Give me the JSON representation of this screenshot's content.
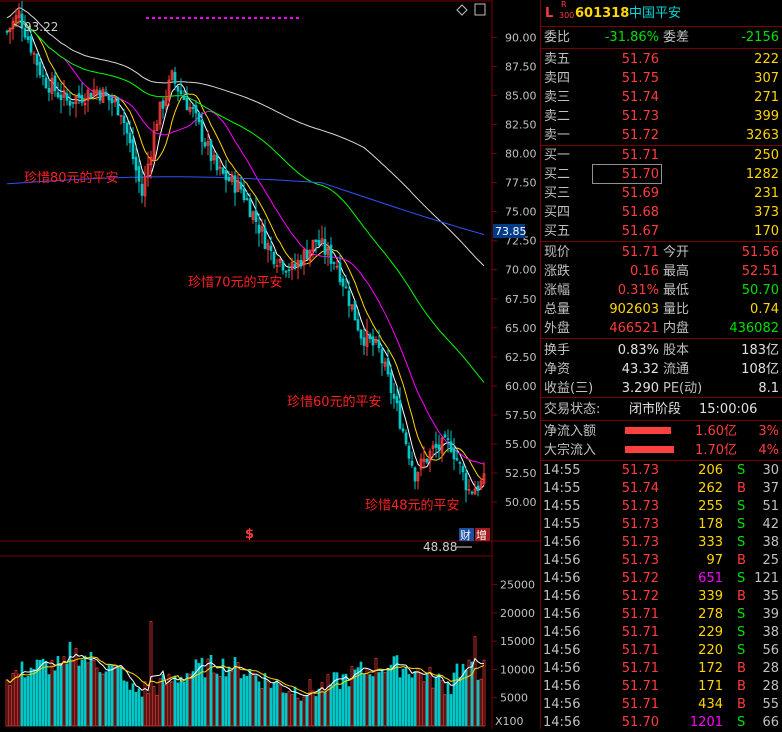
{
  "header": {
    "market_letter": "L",
    "r_mark": "R",
    "index_tag": "300",
    "code": "601318",
    "name": "中国平安"
  },
  "ratio": {
    "label1": "委比",
    "value1": "-31.86%",
    "label2": "委差",
    "value2": "-2156"
  },
  "asks": [
    {
      "label": "卖五",
      "price": "51.76",
      "vol": "222"
    },
    {
      "label": "卖四",
      "price": "51.75",
      "vol": "307"
    },
    {
      "label": "卖三",
      "price": "51.74",
      "vol": "271"
    },
    {
      "label": "卖二",
      "price": "51.73",
      "vol": "399"
    },
    {
      "label": "卖一",
      "price": "51.72",
      "vol": "3263"
    }
  ],
  "bids": [
    {
      "label": "买一",
      "price": "51.71",
      "vol": "250"
    },
    {
      "label": "买二",
      "price": "51.70",
      "vol": "1282"
    },
    {
      "label": "买三",
      "price": "51.69",
      "vol": "231"
    },
    {
      "label": "买四",
      "price": "51.68",
      "vol": "373"
    },
    {
      "label": "买五",
      "price": "51.67",
      "vol": "170"
    }
  ],
  "quote": [
    {
      "l1": "现价",
      "v1": "51.71",
      "l2": "今开",
      "v2": "51.56"
    },
    {
      "l1": "涨跌",
      "v1": "0.16",
      "l2": "最高",
      "v2": "52.51"
    },
    {
      "l1": "涨幅",
      "v1": "0.31%",
      "l2": "最低",
      "v2": "50.70"
    },
    {
      "l1": "总量",
      "v1": "902603",
      "l2": "量比",
      "v2": "0.74"
    },
    {
      "l1": "外盘",
      "v1": "466521",
      "l2": "内盘",
      "v2": "436082"
    }
  ],
  "fund": [
    {
      "l1": "换手",
      "v1": "0.83%",
      "l2": "股本",
      "v2": "183亿"
    },
    {
      "l1": "净资",
      "v1": "43.32",
      "l2": "流通",
      "v2": "108亿"
    },
    {
      "l1": "收益(三)",
      "v1": "3.290",
      "l2": "PE(动)",
      "v2": "8.1"
    }
  ],
  "trade_status": {
    "label": "交易状态:",
    "phase": "闭市阶段",
    "time": "15:00:06"
  },
  "flows": [
    {
      "label": "净流入额",
      "value": "1.60亿",
      "pct": "3%",
      "fill": 0.8
    },
    {
      "label": "大宗流入",
      "value": "1.70亿",
      "pct": "4%",
      "fill": 0.85
    }
  ],
  "ticks": [
    {
      "t": "14:55",
      "p": "51.73",
      "v": "206",
      "s": "S",
      "n": "30"
    },
    {
      "t": "14:55",
      "p": "51.74",
      "v": "262",
      "s": "B",
      "n": "37"
    },
    {
      "t": "14:55",
      "p": "51.73",
      "v": "255",
      "s": "S",
      "n": "51"
    },
    {
      "t": "14:55",
      "p": "51.73",
      "v": "178",
      "s": "S",
      "n": "42"
    },
    {
      "t": "14:56",
      "p": "51.73",
      "v": "333",
      "s": "S",
      "n": "38"
    },
    {
      "t": "14:56",
      "p": "51.73",
      "v": "97",
      "s": "B",
      "n": "25"
    },
    {
      "t": "14:56",
      "p": "51.72",
      "v": "651",
      "s": "S",
      "n": "121"
    },
    {
      "t": "14:56",
      "p": "51.72",
      "v": "339",
      "s": "B",
      "n": "35"
    },
    {
      "t": "14:56",
      "p": "51.71",
      "v": "278",
      "s": "S",
      "n": "39"
    },
    {
      "t": "14:56",
      "p": "51.71",
      "v": "229",
      "s": "S",
      "n": "38"
    },
    {
      "t": "14:56",
      "p": "51.71",
      "v": "220",
      "s": "S",
      "n": "56"
    },
    {
      "t": "14:56",
      "p": "51.71",
      "v": "172",
      "s": "B",
      "n": "28"
    },
    {
      "t": "14:56",
      "p": "51.71",
      "v": "171",
      "s": "B",
      "n": "28"
    },
    {
      "t": "14:56",
      "p": "51.71",
      "v": "434",
      "s": "B",
      "n": "55"
    },
    {
      "t": "14:56",
      "p": "51.70",
      "v": "1201",
      "s": "S",
      "n": "66"
    }
  ],
  "chart_data": {
    "type": "candlestick",
    "price_axis_ticks": [
      "90.00",
      "87.50",
      "85.00",
      "82.50",
      "80.00",
      "77.50",
      "75.00",
      "72.50",
      "70.00",
      "67.50",
      "65.00",
      "62.50",
      "60.00",
      "57.50",
      "55.00",
      "52.50",
      "50.00"
    ],
    "price_ylim": [
      47.6,
      92.7
    ],
    "high_label": "93.22",
    "low_label": "48.88",
    "current_price_tag": "73.85",
    "annotations": [
      {
        "text": "珍惜80元的平安",
        "price": 78.0
      },
      {
        "text": "珍惜70元的平安",
        "price": 69.0
      },
      {
        "text": "珍惜60元的平安",
        "price": 58.7
      },
      {
        "text": "珍惜48元的平安",
        "price": 49.8
      }
    ],
    "volume_axis_ticks": [
      "25000",
      "20000",
      "15000",
      "10000",
      "5000"
    ],
    "volume_ylim": [
      0,
      29000
    ],
    "volume_unit": "X100",
    "markers": {
      "s_mark": "$",
      "cai": "财",
      "zeng": "增"
    },
    "colors": {
      "up": "#ff3c3c",
      "down": "#00c8c8",
      "ma5": "#ffffff",
      "ma10": "#ffd700",
      "ma20": "#ff00ff",
      "ma60": "#00ff00",
      "ma120": "#d8d8d8",
      "ma250": "#3050ff"
    }
  }
}
